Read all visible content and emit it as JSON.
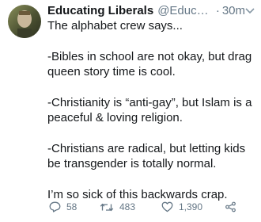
{
  "tweet": {
    "display_name": "Educating Liberals",
    "handle": "@Educatio...",
    "separator": "·",
    "time": "30m",
    "paragraphs": [
      "The alphabet crew says...",
      "-Bibles in school are not okay, but drag queen story time is cool.",
      "-Christianity is “anti-gay”, but Islam is a peaceful & loving religion.",
      "-Christians are radical, but letting kids be transgender is totally normal.",
      "I’m so sick of this backwards crap."
    ],
    "replies": "58",
    "retweets": "483",
    "likes": "1,390"
  },
  "icons": {
    "menu": "chevron-down-icon",
    "reply": "reply-icon",
    "retweet": "retweet-icon",
    "like": "heart-icon",
    "share": "share-icon"
  }
}
